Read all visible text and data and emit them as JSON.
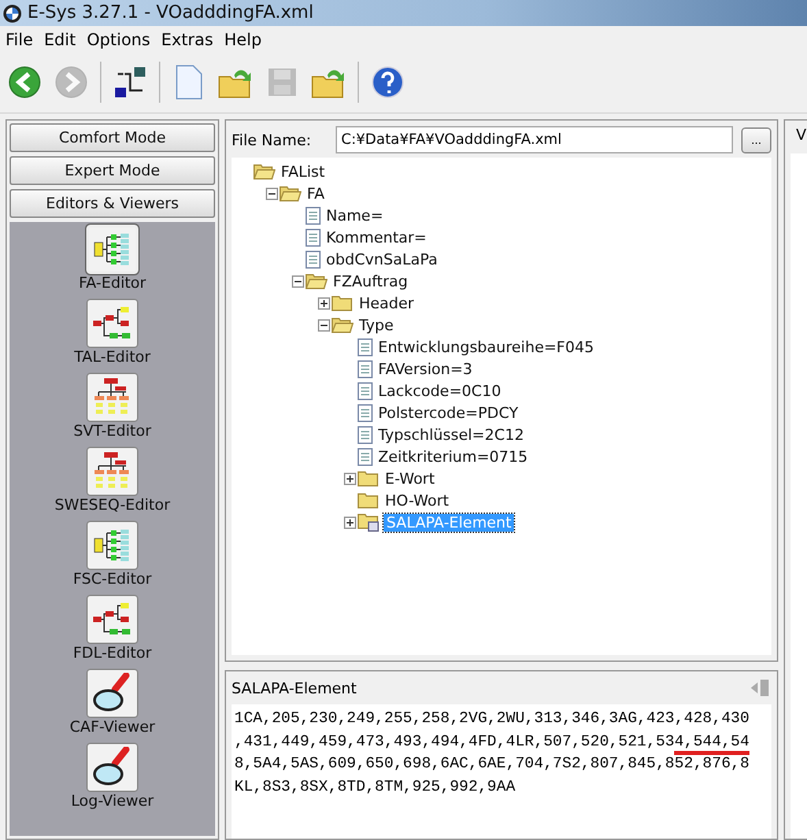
{
  "window": {
    "title": "E-Sys 3.27.1 - VOadddingFA.xml"
  },
  "menu": [
    "File",
    "Edit",
    "Options",
    "Extras",
    "Help"
  ],
  "toolbar": [
    {
      "kind": "back",
      "disabled": false
    },
    {
      "kind": "forward",
      "disabled": true
    },
    {
      "kind": "connect",
      "disabled": false
    },
    {
      "kind": "new",
      "disabled": false
    },
    {
      "kind": "open",
      "disabled": false
    },
    {
      "kind": "save",
      "disabled": true
    },
    {
      "kind": "import",
      "disabled": false
    },
    {
      "kind": "help",
      "disabled": false
    }
  ],
  "sidebar": {
    "modes": [
      "Comfort Mode",
      "Expert Mode",
      "Editors & Viewers"
    ],
    "items": [
      {
        "label": "FA-Editor",
        "kind": "tree",
        "selected": true
      },
      {
        "label": "TAL-Editor",
        "kind": "flow",
        "selected": false
      },
      {
        "label": "SVT-Editor",
        "kind": "hierarchy",
        "selected": false
      },
      {
        "label": "SWESEQ-Editor",
        "kind": "hierarchy",
        "selected": false
      },
      {
        "label": "FSC-Editor",
        "kind": "tree",
        "selected": false
      },
      {
        "label": "FDL-Editor",
        "kind": "flow",
        "selected": false
      },
      {
        "label": "CAF-Viewer",
        "kind": "magnifier",
        "selected": false
      },
      {
        "label": "Log-Viewer",
        "kind": "magnifier",
        "selected": false
      }
    ]
  },
  "file": {
    "label": "File Name:",
    "value": "C:¥Data¥FA¥VOadddingFA.xml",
    "browse": "..."
  },
  "tree": [
    {
      "label": "FAList",
      "kind": "folder",
      "selected": false,
      "children": [
        {
          "label": "FA",
          "kind": "folder",
          "expanded": true,
          "selected": false,
          "children": [
            {
              "label": "Name=",
              "kind": "file",
              "selected": false
            },
            {
              "label": "Kommentar=",
              "kind": "file",
              "selected": false
            },
            {
              "label": "obdCvnSaLaPa",
              "kind": "file",
              "selected": false
            },
            {
              "label": "FZAuftrag",
              "kind": "folder",
              "expanded": true,
              "selected": false,
              "children": [
                {
                  "label": "Header",
                  "kind": "folder",
                  "expanded": false,
                  "selected": false
                },
                {
                  "label": "Type",
                  "kind": "folder",
                  "expanded": true,
                  "selected": false,
                  "children": [
                    {
                      "label": "Entwicklungsbaureihe=F045",
                      "kind": "file",
                      "selected": false
                    },
                    {
                      "label": "FAVersion=3",
                      "kind": "file",
                      "selected": false
                    },
                    {
                      "label": "Lackcode=0C10",
                      "kind": "file",
                      "selected": false
                    },
                    {
                      "label": "Polstercode=PDCY",
                      "kind": "file",
                      "selected": false
                    },
                    {
                      "label": "Typschlüssel=2C12",
                      "kind": "file",
                      "selected": false
                    },
                    {
                      "label": "Zeitkriterium=0715",
                      "kind": "file",
                      "selected": false
                    },
                    {
                      "label": "E-Wort",
                      "kind": "folder",
                      "expanded": false,
                      "selected": false
                    },
                    {
                      "label": "HO-Wort",
                      "kind": "folder",
                      "selected": false
                    },
                    {
                      "label": "SALAPA-Element",
                      "kind": "element",
                      "expanded": false,
                      "selected": true
                    }
                  ]
                }
              ]
            }
          ]
        }
      ]
    }
  ],
  "detail": {
    "title": "SALAPA-Element",
    "lines": [
      [
        {
          "text": "1CA,205,230,249,255,258,2VG,2WU,313,346,3AG,423,428,430",
          "marked": false
        }
      ],
      [
        {
          "text": ",431,449,459,473,493,494,4FD,4LR,507,520,521,53",
          "marked": false
        },
        {
          "text": "4,544,54",
          "marked": true
        }
      ],
      [
        {
          "text": "8,5A4,5AS,609,650,698,6AC,6AE,704,7S2,807,845,852,876,8",
          "marked": false
        }
      ],
      [
        {
          "text": "KL,8S3,8SX,8TD,8TM,925,992,9AA",
          "marked": false
        }
      ]
    ]
  },
  "right_panel": {
    "title": "V"
  }
}
